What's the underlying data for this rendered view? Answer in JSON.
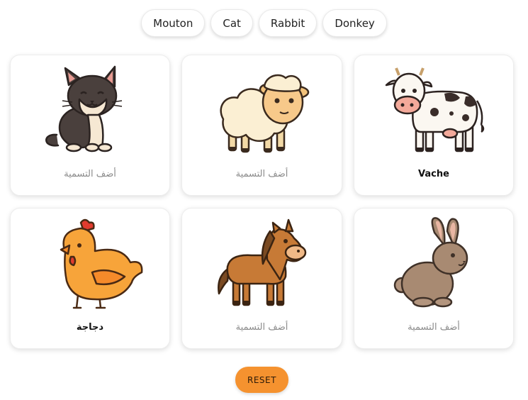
{
  "chips": [
    {
      "label": "Mouton"
    },
    {
      "label": "Cat"
    },
    {
      "label": "Rabbit"
    },
    {
      "label": "Donkey"
    }
  ],
  "cards": [
    {
      "animal": "cat-illustration",
      "label": "أضف التسمية"
    },
    {
      "animal": "sheep-illustration",
      "label": "أضف التسمية"
    },
    {
      "animal": "cow-illustration",
      "label": "Vache"
    },
    {
      "animal": "chicken-illustration",
      "label": "دجاجة"
    },
    {
      "animal": "horse-illustration",
      "label": "أضف التسمية"
    },
    {
      "animal": "rabbit-illustration",
      "label": "أضف التسمية"
    }
  ],
  "reset_label": "RESET",
  "colors": {
    "accent": "#f5922f",
    "placeholder": "#8a8a8a"
  }
}
